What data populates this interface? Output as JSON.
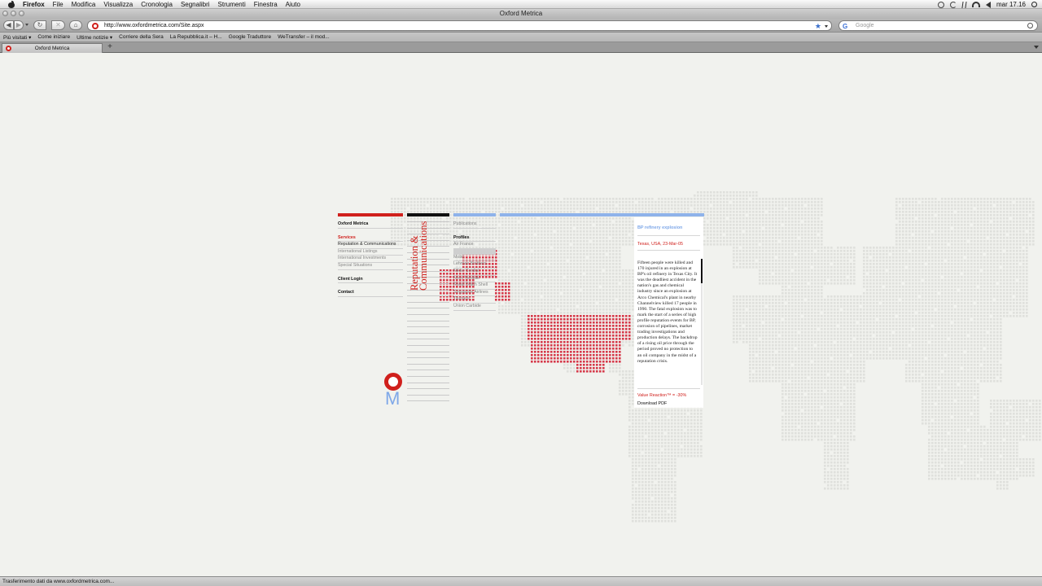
{
  "os": {
    "app_name": "Firefox",
    "menus": [
      "File",
      "Modifica",
      "Visualizza",
      "Cronologia",
      "Segnalibri",
      "Strumenti",
      "Finestra",
      "Aiuto"
    ],
    "clock": "mar 17.16"
  },
  "window": {
    "title": "Oxford Metrica"
  },
  "nav": {
    "back": "◀",
    "forward": "▶",
    "reload": "↻",
    "stop": "✕",
    "home": "⌂",
    "url": "http://www.oxfordmetrica.com/Site.aspx",
    "star": "★",
    "search_engine_glyph": "G",
    "search_placeholder": "Google"
  },
  "bookmarks": [
    "Più visitati ▾",
    "Come iniziare",
    "Ultime notizie ▾",
    "Corriere della Sera",
    "La Repubblica.it – H...",
    "Google Traduttore",
    "WeTransfer – il mod..."
  ],
  "tab": {
    "label": "Oxford Metrica",
    "add": "+"
  },
  "status": "Trasferimento dati da www.oxfordmetrica.com...",
  "colors": {
    "accent_red": "#d0201c",
    "accent_blue": "#7fa8e8",
    "map_dots": "#dfe0dc",
    "highlight_dots": "#d63a4a"
  },
  "site": {
    "brand": "Oxford Metrica",
    "services": "Services",
    "service_items": [
      "Reputation & Communications",
      "International Listings",
      "International Investments",
      "Special Situations"
    ],
    "client_login": "Client Login",
    "contact": "Contact",
    "vertical_title": [
      "Reputation &",
      "Communications"
    ],
    "logo_m": "M",
    "publications": "Publications",
    "profiles_header": "Profiles",
    "profiles": [
      "Air France",
      "",
      "",
      "",
      "",
      "",
      "",
      "",
      "Mobil",
      "Lehman Brothers",
      "Nikko Cordial",
      "Novo Nordisk",
      "Royal Dutch Shell",
      "Singapore Airlines",
      "Tsunami",
      "Union Carbide"
    ]
  },
  "case": {
    "title": "BP refinery explosion",
    "place": "Texas, USA, 23-Mar-05",
    "body": "Fifteen people were killed and 170 injured in an explosion at BP's oil refinery in Texas City. It was the deadliest accident in the nation's gas and chemical industry since an explosion at Arco Chemical's plant in nearby Channelview killed 17 people in 1990. The fatal explosion was to mark the start of a series of high profile reputation events for BP, corrosion of pipelines, market trading investigations and production delays. The backdrop of a rising oil price through the period proved no protection to an oil company in the midst of a reputation crisis.",
    "value_reaction": "Value Reaction™ = -30%",
    "download": "Download PDF"
  }
}
